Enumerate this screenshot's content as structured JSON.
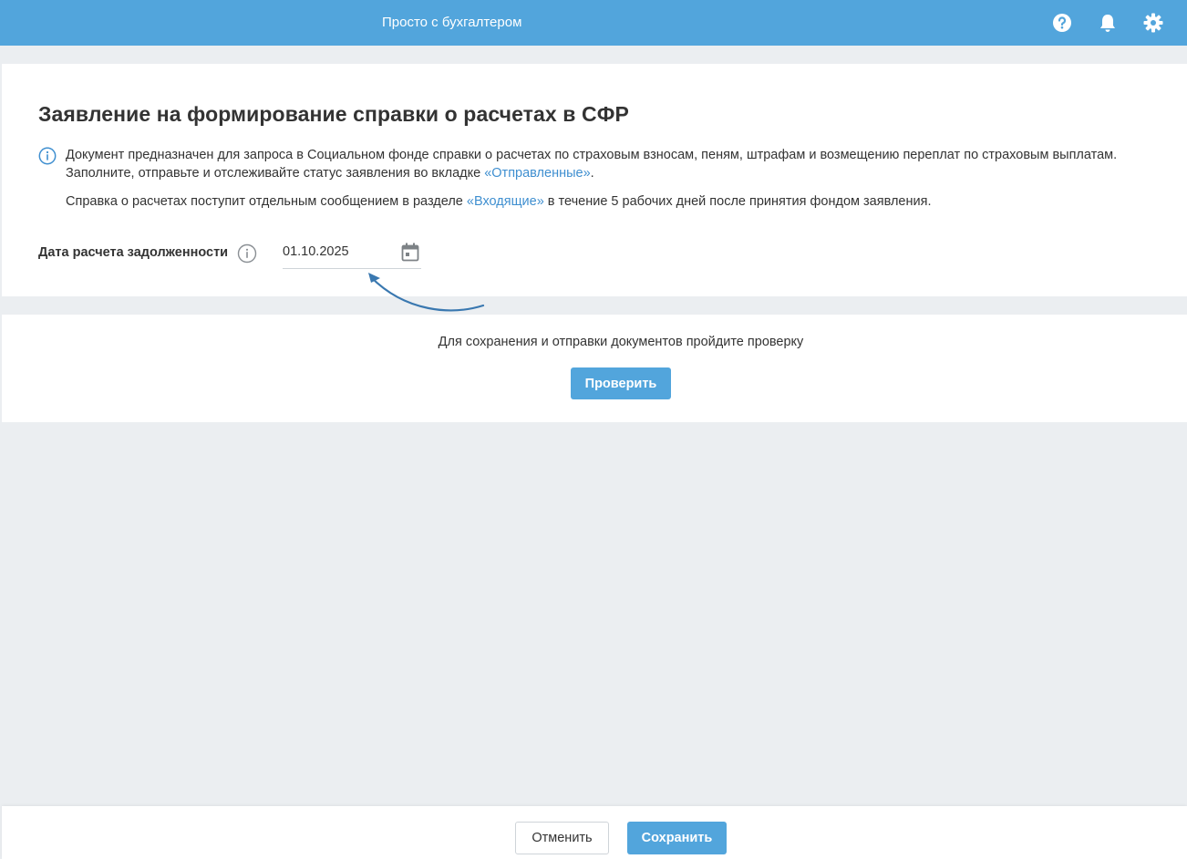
{
  "header": {
    "title": "Просто с бухгалтером",
    "icons": [
      "help-icon",
      "bell-icon",
      "gear-icon"
    ],
    "color": "#52a5dc"
  },
  "form": {
    "heading": "Заявление на формирование справки о расчетах в СФР",
    "info_line1": "Документ предназначен для запроса в Социальном фонде справки о расчетах по страховым взносам, пеням, штрафам и возмещению переплат по страховым выплатам.",
    "info_line2_prefix": "Заполните, отправьте и отслеживайте статус заявления во вкладке ",
    "info_line2_link": "«Отправленные»",
    "info_line2_suffix": ".",
    "info_line3_prefix": "Справка о расчетах поступит отдельным сообщением в разделе ",
    "info_line3_link": "«Входящие»",
    "info_line3_suffix": " в течение 5 рабочих дней после принятия фондом заявления.",
    "date_label": "Дата расчета задолженности",
    "date_value": "01.10.2025"
  },
  "check": {
    "text": "Для сохранения и отправки документов пройдите проверку",
    "button": "Проверить"
  },
  "footer": {
    "cancel": "Отменить",
    "save": "Сохранить"
  },
  "colors": {
    "accent": "#52a5dc",
    "link": "#3f8fd0",
    "background": "#ebeef1"
  }
}
